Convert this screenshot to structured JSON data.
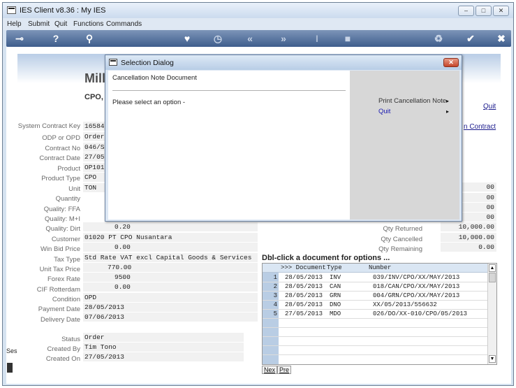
{
  "window": {
    "title": "IES Client v8.36 : My IES",
    "controls": [
      "minimize",
      "maximize",
      "close"
    ]
  },
  "menu": [
    "Help",
    "Submit",
    "Quit",
    "Functions",
    "Commands"
  ],
  "toolbar": {
    "icons": [
      "key-icon",
      "help-icon",
      "search-icon",
      "heart-icon",
      "clock-icon",
      "back-icon",
      "forward-icon",
      "text-cursor-icon",
      "stop-icon",
      "recycle-icon",
      "check-icon",
      "close-icon"
    ]
  },
  "header": {
    "company": "Mill",
    "doc_title": "CPO, K",
    "quit_link": "Quit",
    "contract_link": "n Contract"
  },
  "fields": [
    {
      "label": "System Contract Key",
      "value": "165848"
    },
    {
      "label": "ODP or OPD",
      "value": "Order."
    },
    {
      "label": "Contract No",
      "value": "046/SP"
    },
    {
      "label": "Contract Date",
      "value": "27/05/"
    },
    {
      "label": "Product",
      "value": "OP101"
    },
    {
      "label": "Product Type",
      "value": "CPO"
    },
    {
      "label": "Unit",
      "value": "TON"
    },
    {
      "label": "Quantity",
      "value": ""
    },
    {
      "label": "Quality: FFA",
      "value": ""
    },
    {
      "label": "Quality: M+I",
      "value": ""
    },
    {
      "label": "Quality: Dirt",
      "value": "0.20"
    },
    {
      "label": "Customer",
      "value": "01020 PT CPO Nusantara"
    },
    {
      "label": "Win Bid Price",
      "value": "0.00"
    },
    {
      "label": "Tax Type",
      "value": "Std Rate VAT excl Capital Goods & Services"
    },
    {
      "label": "Unit Tax Price",
      "value": "770.00"
    },
    {
      "label": "Forex Rate",
      "value": "9500"
    },
    {
      "label": "CIF Rotterdam",
      "value": "0.00"
    },
    {
      "label": "Condition",
      "value": "OPD"
    },
    {
      "label": "Payment Date",
      "value": "28/05/2013"
    },
    {
      "label": "Delivery Date",
      "value": "07/06/2013"
    }
  ],
  "status_fields": [
    {
      "label": "Status",
      "value": "Order"
    },
    {
      "label": "Created By",
      "value": "Tim Tono"
    },
    {
      "label": "Created On",
      "value": "27/05/2013"
    }
  ],
  "right_values": [
    {
      "label": "",
      "value": "00"
    },
    {
      "label": "",
      "value": "00"
    },
    {
      "label": "",
      "value": "00"
    },
    {
      "label": "",
      "value": "00"
    },
    {
      "label": "Qty Returned",
      "value": "10,000.00"
    },
    {
      "label": "Qty Cancelled",
      "value": "10,000.00"
    },
    {
      "label": "Qty Remaining",
      "value": "0.00"
    }
  ],
  "documents": {
    "title": "Dbl-click a document for options ...",
    "columns": [
      ">>> Document",
      "Type",
      "Number"
    ],
    "rows": [
      {
        "n": "1",
        "date": "28/05/2013",
        "type": "INV",
        "number": "039/INV/CPO/XX/MAY/2013"
      },
      {
        "n": "2",
        "date": "28/05/2013",
        "type": "CAN",
        "number": "018/CAN/CPO/XX/MAY/2013"
      },
      {
        "n": "3",
        "date": "28/05/2013",
        "type": "GRN",
        "number": "004/GRN/CPO/XX/MAY/2013"
      },
      {
        "n": "4",
        "date": "28/05/2013",
        "type": "DNO",
        "number": "XX/05/2013/556632"
      },
      {
        "n": "5",
        "date": "27/05/2013",
        "type": "MDO",
        "number": "026/DO/XX-010/CPO/05/2013"
      }
    ],
    "nav": [
      "Nex",
      "Pre"
    ]
  },
  "side_fragment": "Ses",
  "dialog": {
    "title": "Selection Dialog",
    "heading": "Cancellation Note Document",
    "prompt": "Please select an option -",
    "options": [
      {
        "label": "Print Cancellation Note",
        "arrow": "▸",
        "color": "#333333"
      },
      {
        "label": "Quit",
        "arrow": "▸",
        "color": "#1a1ab0"
      }
    ]
  }
}
